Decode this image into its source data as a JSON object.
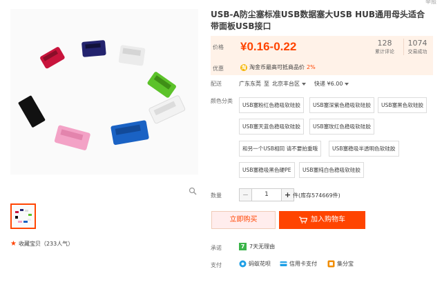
{
  "top_hint": "举报",
  "product": {
    "title": "USB-A防尘塞标准USB数据塞大USB HUB通用母头适合带面板USB接口"
  },
  "price": {
    "label": "价格",
    "value": "¥0.16-0.22",
    "stats": [
      {
        "num": "128",
        "label": "累计评论"
      },
      {
        "num": "1074",
        "label": "交易成功"
      }
    ]
  },
  "promo": {
    "label": "优惠",
    "coin_char": "淘",
    "text": "淘金币最高可抵商品价",
    "percent": "2%"
  },
  "shipping": {
    "label": "配送",
    "from": "广东东莞",
    "to_word": "至",
    "to": "北京丰台区",
    "method": "快递 ¥6.00"
  },
  "sku": {
    "label": "颜色分类",
    "options": [
      "USB塞粉红色稳吸软硅胶",
      "USB塞深紫色稳吸软硅胶",
      "USB塞黑色软硅胶",
      "USB塞天蓝色稳吸软硅胶",
      "USB塞玫红色稳吸软硅胶",
      "和另一个USB相同 请不要拍重哦",
      "USB塞稳吸半透明色软硅胶",
      "USB塞稳吸黑色硬PE",
      "USB塞纯白色稳吸软硅胶"
    ]
  },
  "quantity": {
    "label": "数量",
    "minus": "−",
    "value": "1",
    "plus": "+",
    "stock": "件(库存574669件)"
  },
  "actions": {
    "buy_now": "立即购买",
    "add_cart": "加入购物车"
  },
  "promise": {
    "label": "承诺",
    "badge": "7",
    "text": "7天无理由"
  },
  "payment": {
    "label": "支付",
    "methods": [
      "蚂蚁花呗",
      "信用卡支付",
      "集分宝"
    ]
  },
  "favorite": {
    "text": "收藏宝贝（233人气）"
  },
  "colors": {
    "accent": "#ff4400",
    "price_bg": "#fff2e8"
  }
}
